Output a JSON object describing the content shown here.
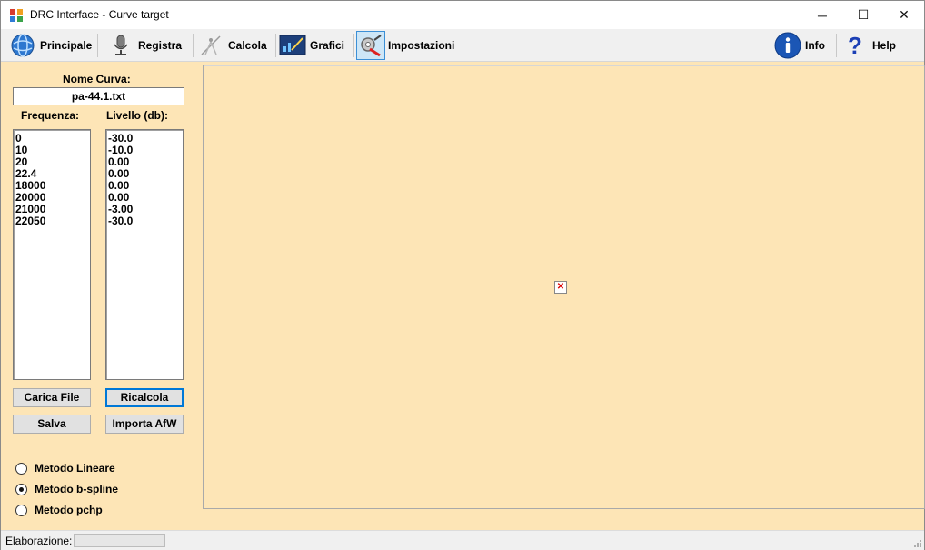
{
  "window": {
    "title": "DRC Interface - Curve target",
    "minimize": "─",
    "maximize": "☐",
    "close": "✕"
  },
  "toolbar": {
    "items": [
      {
        "label": "Principale",
        "icon": "globe-icon"
      },
      {
        "label": "Registra",
        "icon": "microphone-icon"
      },
      {
        "label": "Calcola",
        "icon": "compass-icon"
      },
      {
        "label": "Grafici",
        "icon": "chart-icon"
      },
      {
        "label": "Impostazioni",
        "icon": "settings-icon"
      }
    ],
    "info_label": "Info",
    "help_label": "Help",
    "active": "Impostazioni"
  },
  "panel": {
    "curve_name_label": "Nome Curva:",
    "curve_name_value": "pa-44.1.txt",
    "freq_label": "Frequenza:",
    "level_label": "Livello (db):",
    "frequencies": [
      "0",
      "10",
      "20",
      "22.4",
      "18000",
      "20000",
      "21000",
      "22050"
    ],
    "levels": [
      "-30.0",
      "-10.0",
      "0.00",
      "0.00",
      "0.00",
      "0.00",
      "-3.00",
      "-30.0"
    ],
    "buttons": {
      "load": "Carica File",
      "recalc": "Ricalcola",
      "save": "Salva",
      "import": "Importa AfW"
    },
    "methods": [
      {
        "label": "Metodo Lineare",
        "selected": false
      },
      {
        "label": "Metodo b-spline",
        "selected": true
      },
      {
        "label": "Metodo pchp",
        "selected": false
      }
    ]
  },
  "plot": {
    "broken_image_glyph": "✕"
  },
  "status": {
    "label": "Elaborazione:",
    "progress": 0
  },
  "colors": {
    "panel_bg": "#fde5b6",
    "toolbar_bg": "#f0f0f0",
    "accent": "#0078d7"
  }
}
